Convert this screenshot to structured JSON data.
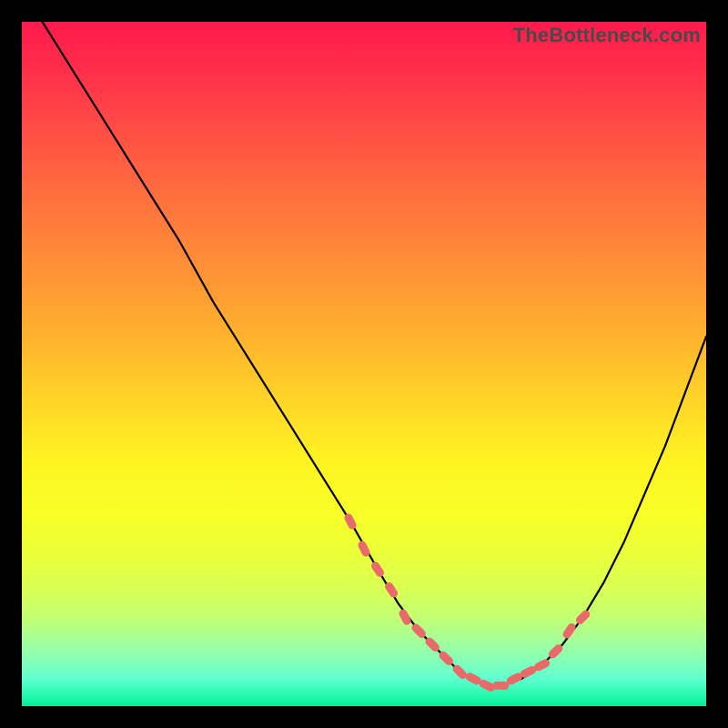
{
  "watermark": "TheBottleneck.com",
  "colors": {
    "page_bg": "#000000",
    "gradient_top": "#ff1a4d",
    "gradient_mid": "#fff322",
    "gradient_bottom": "#0fe69b",
    "curve": "#000000",
    "marker": "#e86a6a"
  },
  "chart_data": {
    "type": "line",
    "title": "",
    "xlabel": "",
    "ylabel": "",
    "xlim": [
      0,
      100
    ],
    "ylim": [
      0,
      100
    ],
    "series": [
      {
        "name": "bottleneck-curve",
        "x": [
          3,
          8,
          13,
          18,
          23,
          28,
          33,
          38,
          43,
          48,
          52,
          55,
          58,
          61,
          64,
          66,
          68,
          70,
          73,
          76,
          79,
          82,
          85,
          88,
          91,
          94,
          97,
          100
        ],
        "y": [
          100,
          92,
          84,
          76,
          68,
          59,
          51,
          43,
          35,
          27,
          20,
          15,
          11,
          8,
          5,
          4,
          3,
          3,
          4,
          6,
          9,
          13,
          18,
          24,
          31,
          38,
          46,
          54
        ]
      }
    ],
    "markers": {
      "name": "highlighted-points",
      "x": [
        48,
        50,
        52,
        54,
        56,
        58,
        60,
        62,
        64,
        66,
        68,
        70,
        72,
        74,
        76,
        78,
        80,
        82
      ],
      "y": [
        27,
        23,
        20,
        17,
        13,
        11,
        9,
        7,
        5,
        4,
        3,
        3,
        4,
        5,
        6,
        8,
        11,
        13
      ]
    }
  }
}
